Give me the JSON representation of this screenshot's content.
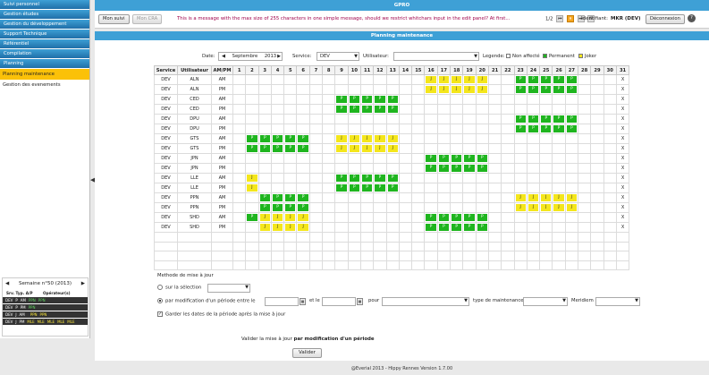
{
  "sidebar": {
    "items": [
      {
        "label": "Suivi personnel",
        "active": false
      },
      {
        "label": "Gestion études",
        "active": false
      },
      {
        "label": "Gestion du développement",
        "active": false
      },
      {
        "label": "Support Technique",
        "active": false
      },
      {
        "label": "Référentiel",
        "active": false
      },
      {
        "label": "Compilation",
        "active": false
      },
      {
        "label": "Planning",
        "active": false
      }
    ],
    "subitems": [
      {
        "label": "Planning maintenance",
        "active": true
      },
      {
        "label": "Gestion des evenements",
        "active": false
      }
    ],
    "week": {
      "title": "Semaine n°50 (2013)",
      "prev": "◀",
      "next": "▶",
      "col_srv": "Srv.",
      "col_typ": "Typ.",
      "col_ap": "A/P",
      "col_op": "Opérateur(s)",
      "rows": [
        {
          "srv": "DEV",
          "typ": "P",
          "ap": "AM",
          "ops": [
            {
              "t": "PPN",
              "c": "g"
            },
            {
              "t": "PPN",
              "c": "g"
            }
          ]
        },
        {
          "srv": "DEV",
          "typ": "P",
          "ap": "PM",
          "ops": [
            {
              "t": "PPN",
              "c": "g"
            }
          ]
        },
        {
          "srv": "DEV",
          "typ": "J",
          "ap": "AM",
          "ops": [
            {
              "t": "",
              "c": "y"
            },
            {
              "t": "PPN",
              "c": "y"
            },
            {
              "t": "PPN",
              "c": "y"
            }
          ]
        },
        {
          "srv": "DEV",
          "typ": "J",
          "ap": "PM",
          "ops": [
            {
              "t": "MLE",
              "c": "y"
            },
            {
              "t": "MLE",
              "c": "y"
            },
            {
              "t": "MLE",
              "c": "y"
            },
            {
              "t": "MLE",
              "c": "y"
            },
            {
              "t": "MLE",
              "c": "y"
            }
          ]
        }
      ]
    }
  },
  "top": {
    "app_title": "GPRO",
    "btn_mon_suivi": "Mon suivi",
    "btn_mon_cra": "Mon CRA",
    "message": "This is a message with the max size of 255 characters in one simple message, should we restrict whitchars input in the edit panel? At first...",
    "pager": "1/2",
    "pager_icons": [
      "⏮",
      "⏸",
      "⏭",
      "✉"
    ],
    "ident_label": "Identifiant:",
    "ident_value": "MKR (DEV)",
    "btn_logout": "Déconnexion",
    "help_icon": "?"
  },
  "panel": {
    "title": "Planning maintenance",
    "filters": {
      "date_label": "Date:",
      "date_prev": "◀",
      "date_value": "Septembre",
      "date_year": "2013",
      "date_next": "▶",
      "service_label": "Service:",
      "service_value": "DEV",
      "user_label": "Utilisateur:",
      "user_value": "",
      "legend_label": "Legende:",
      "legend_none": "Non affecté",
      "legend_perm": "Permanent",
      "legend_joker": "Joker"
    },
    "colors": {
      "permanent": "#1fb51f",
      "joker": "#f4e61c",
      "accent": "#3ea0d6",
      "selected": "#fbc108"
    },
    "grid": {
      "headers": [
        "Service",
        "Utilisateur",
        "AM/PM"
      ],
      "days": [
        "1",
        "2",
        "3",
        "4",
        "5",
        "6",
        "7",
        "8",
        "9",
        "10",
        "11",
        "12",
        "13",
        "14",
        "15",
        "16",
        "17",
        "18",
        "19",
        "20",
        "21",
        "22",
        "23",
        "24",
        "25",
        "26",
        "27",
        "28",
        "29",
        "30",
        "31"
      ],
      "rows": [
        {
          "service": "DEV",
          "user": "ALN",
          "ampm": "AM",
          "marks": {
            "16": "J",
            "17": "J",
            "18": "J",
            "19": "J",
            "20": "J",
            "23": "P",
            "24": "P",
            "25": "P",
            "26": "P",
            "27": "P"
          },
          "end": "X"
        },
        {
          "service": "DEV",
          "user": "ALN",
          "ampm": "PM",
          "marks": {
            "16": "J",
            "17": "J",
            "18": "J",
            "19": "J",
            "20": "J",
            "23": "P",
            "24": "P",
            "25": "P",
            "26": "P",
            "27": "P"
          },
          "end": "X"
        },
        {
          "service": "DEV",
          "user": "CED",
          "ampm": "AM",
          "marks": {
            "9": "P",
            "10": "P",
            "11": "P",
            "12": "P",
            "13": "P"
          },
          "end": "X"
        },
        {
          "service": "DEV",
          "user": "CED",
          "ampm": "PM",
          "marks": {
            "9": "P",
            "10": "P",
            "11": "P",
            "12": "P",
            "13": "P"
          },
          "end": "X"
        },
        {
          "service": "DEV",
          "user": "DPU",
          "ampm": "AM",
          "marks": {
            "23": "P",
            "24": "P",
            "25": "P",
            "26": "P",
            "27": "P"
          },
          "end": "X"
        },
        {
          "service": "DEV",
          "user": "DPU",
          "ampm": "PM",
          "marks": {
            "23": "P",
            "24": "P",
            "25": "P",
            "26": "P",
            "27": "P"
          },
          "end": "X"
        },
        {
          "service": "DEV",
          "user": "GTS",
          "ampm": "AM",
          "marks": {
            "2": "P",
            "3": "P",
            "4": "P",
            "5": "P",
            "6": "P",
            "9": "J",
            "10": "J",
            "11": "J",
            "12": "J",
            "13": "J"
          },
          "end": "X"
        },
        {
          "service": "DEV",
          "user": "GTS",
          "ampm": "PM",
          "marks": {
            "2": "P",
            "3": "P",
            "4": "P",
            "5": "P",
            "6": "P",
            "9": "J",
            "10": "J",
            "11": "J",
            "12": "J",
            "13": "J"
          },
          "end": "X"
        },
        {
          "service": "DEV",
          "user": "JPN",
          "ampm": "AM",
          "marks": {
            "16": "P",
            "17": "P",
            "18": "P",
            "19": "P",
            "20": "P"
          },
          "end": "X"
        },
        {
          "service": "DEV",
          "user": "JPN",
          "ampm": "PM",
          "marks": {
            "16": "P",
            "17": "P",
            "18": "P",
            "19": "P",
            "20": "P"
          },
          "end": "X"
        },
        {
          "service": "DEV",
          "user": "LLE",
          "ampm": "AM",
          "marks": {
            "2": "J",
            "9": "P",
            "10": "P",
            "11": "P",
            "12": "P",
            "13": "P"
          },
          "end": "X"
        },
        {
          "service": "DEV",
          "user": "LLE",
          "ampm": "PM",
          "marks": {
            "2": "J",
            "9": "P",
            "10": "P",
            "11": "P",
            "12": "P",
            "13": "P"
          },
          "end": "X"
        },
        {
          "service": "DEV",
          "user": "PPN",
          "ampm": "AM",
          "marks": {
            "3": "P",
            "4": "P",
            "5": "P",
            "6": "P",
            "23": "J",
            "24": "J",
            "25": "J",
            "26": "J",
            "27": "J"
          },
          "end": "X"
        },
        {
          "service": "DEV",
          "user": "PPN",
          "ampm": "PM",
          "marks": {
            "3": "P",
            "4": "P",
            "5": "P",
            "6": "P",
            "23": "J",
            "24": "J",
            "25": "J",
            "26": "J",
            "27": "J"
          },
          "end": "X"
        },
        {
          "service": "DEV",
          "user": "SHD",
          "ampm": "AM",
          "marks": {
            "2": "P",
            "3": "J",
            "4": "J",
            "5": "J",
            "6": "J",
            "16": "P",
            "17": "P",
            "18": "P",
            "19": "P",
            "20": "P"
          },
          "end": "X"
        },
        {
          "service": "DEV",
          "user": "SHD",
          "ampm": "PM",
          "marks": {
            "3": "J",
            "4": "J",
            "5": "J",
            "6": "J",
            "16": "P",
            "17": "P",
            "18": "P",
            "19": "P",
            "20": "P"
          },
          "end": "X"
        }
      ]
    },
    "form": {
      "method_title": "Methode de mise à jour",
      "opt_selection": "sur la sélection",
      "opt_period": "par modification d'un période entre le",
      "and_label": "et le",
      "for_label": "pour",
      "type_label": "type de maintenance",
      "meridiem_label": "Meridiem",
      "keep_dates": "Garder les dates de la période après la mise à jour",
      "validate_prefix": "Valider la mise à jour",
      "validate_bold": "par modification d'un période",
      "validate_btn": "Valider"
    }
  },
  "footer": "@Everial 2013 - Hippy Rennes  Version 1.7.00"
}
